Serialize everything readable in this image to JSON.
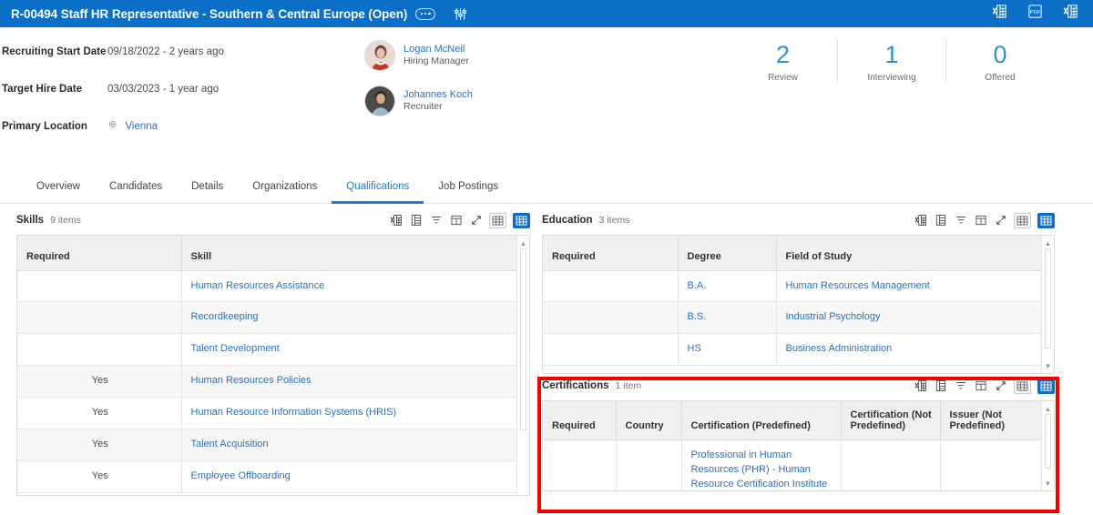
{
  "header": {
    "title": "R-00494 Staff HR Representative - Southern & Central Europe (Open)",
    "ellipsis_label": "related-actions",
    "sliders_label": "view-options",
    "right_icons": [
      {
        "name": "export-excel-icon",
        "label": "Export to Excel"
      },
      {
        "name": "export-pdf-icon",
        "label": "PDF"
      },
      {
        "name": "export-excel-alt-icon",
        "label": "Export to Excel"
      }
    ],
    "accent_color": "#0B6FC8"
  },
  "summary": {
    "facts": [
      {
        "label": "Recruiting Start Date",
        "value": "09/18/2022 - 2 years ago",
        "link": false
      },
      {
        "label": "Target Hire Date",
        "value": "03/03/2023 - 1 year ago",
        "link": false
      },
      {
        "label": "Primary Location",
        "value": "Vienna",
        "link": true
      }
    ],
    "people": [
      {
        "name": "Logan McNeil",
        "role": "Hiring Manager"
      },
      {
        "name": "Johannes Koch",
        "role": "Recruiter"
      }
    ],
    "stats": [
      {
        "value": "2",
        "label": "Review"
      },
      {
        "value": "1",
        "label": "Interviewing"
      },
      {
        "value": "0",
        "label": "Offered"
      }
    ],
    "stat_color": "#2e93c9"
  },
  "tabs": [
    {
      "label": "Overview",
      "active": false
    },
    {
      "label": "Candidates",
      "active": false
    },
    {
      "label": "Details",
      "active": false
    },
    {
      "label": "Organizations",
      "active": false
    },
    {
      "label": "Qualifications",
      "active": true
    },
    {
      "label": "Job Postings",
      "active": false
    }
  ],
  "toolbar_icons": [
    {
      "name": "export-excel-icon",
      "label": "Export to Excel"
    },
    {
      "name": "table-view-icon",
      "label": "View as table"
    },
    {
      "name": "filter-icon",
      "label": "Filter"
    },
    {
      "name": "freeze-columns-icon",
      "label": "Freeze columns"
    },
    {
      "name": "expand-icon",
      "label": "Expand"
    },
    {
      "name": "grid-compact-icon",
      "label": "Compact grid"
    },
    {
      "name": "grid-dense-icon",
      "label": "Dense grid"
    }
  ],
  "panels": {
    "skills": {
      "title": "Skills",
      "count": "9 items",
      "columns": [
        "Required",
        "Skill"
      ],
      "rows": [
        {
          "required": "",
          "skill": "Human Resources Assistance"
        },
        {
          "required": "",
          "skill": "Recordkeeping"
        },
        {
          "required": "",
          "skill": "Talent Development"
        },
        {
          "required": "Yes",
          "skill": "Human Resources Policies"
        },
        {
          "required": "Yes",
          "skill": "Human Resource Information Systems (HRIS)"
        },
        {
          "required": "Yes",
          "skill": "Talent Acquisition"
        },
        {
          "required": "Yes",
          "skill": "Employee Offboarding"
        }
      ]
    },
    "education": {
      "title": "Education",
      "count": "3 items",
      "columns": [
        "Required",
        "Degree",
        "Field of Study"
      ],
      "rows": [
        {
          "required": "",
          "degree": "B.A.",
          "field": "Human Resources Management"
        },
        {
          "required": "",
          "degree": "B.S.",
          "field": "Industrial Psychology"
        },
        {
          "required": "",
          "degree": "HS",
          "field": "Business Administration"
        }
      ]
    },
    "certifications": {
      "title": "Certifications",
      "count": "1 item",
      "columns": [
        "Required",
        "Country",
        "Certification (Predefined)",
        "Certification (Not Predefined)",
        "Issuer (Not Predefined)"
      ],
      "rows": [
        {
          "required": "",
          "country": "",
          "predefined": "Professional in Human Resources (PHR) - Human Resource Certification Institute",
          "not_predefined": "",
          "issuer": ""
        }
      ],
      "highlight_color": "#f20000"
    }
  }
}
